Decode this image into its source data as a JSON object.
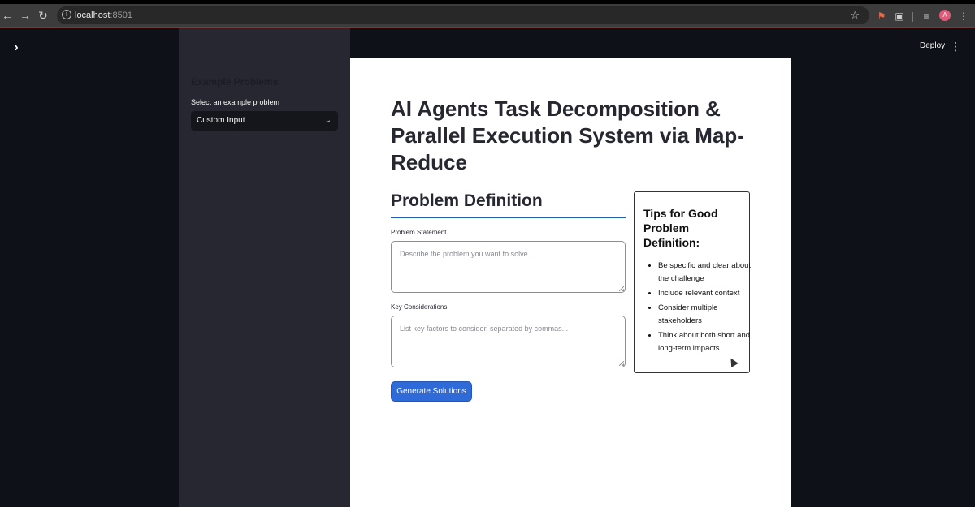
{
  "browser": {
    "url_host": "localhost",
    "url_port": ":8501",
    "back_icon": "arrow-left-icon",
    "forward_icon": "arrow-right-icon",
    "reload_icon": "reload-icon",
    "avatar_initial": "A"
  },
  "app": {
    "deploy_label": "Deploy"
  },
  "sidebar": {
    "title": "Example Problems",
    "select_label": "Select an example problem",
    "select_value": "Custom Input"
  },
  "main": {
    "title": "AI Agents Task Decomposition & Parallel Execution System via Map-Reduce",
    "section_title": "Problem Definition",
    "problem_label": "Problem Statement",
    "problem_placeholder": "Describe the problem you want to solve...",
    "considerations_label": "Key Considerations",
    "considerations_placeholder": "List key factors to consider, separated by commas...",
    "generate_button": "Generate Solutions"
  },
  "tips": {
    "title": "Tips for Good Problem Definition:",
    "items": [
      "Be specific and clear about the challenge",
      "Include relevant context",
      "Consider multiple stakeholders",
      "Think about both short and long-term impacts"
    ]
  }
}
